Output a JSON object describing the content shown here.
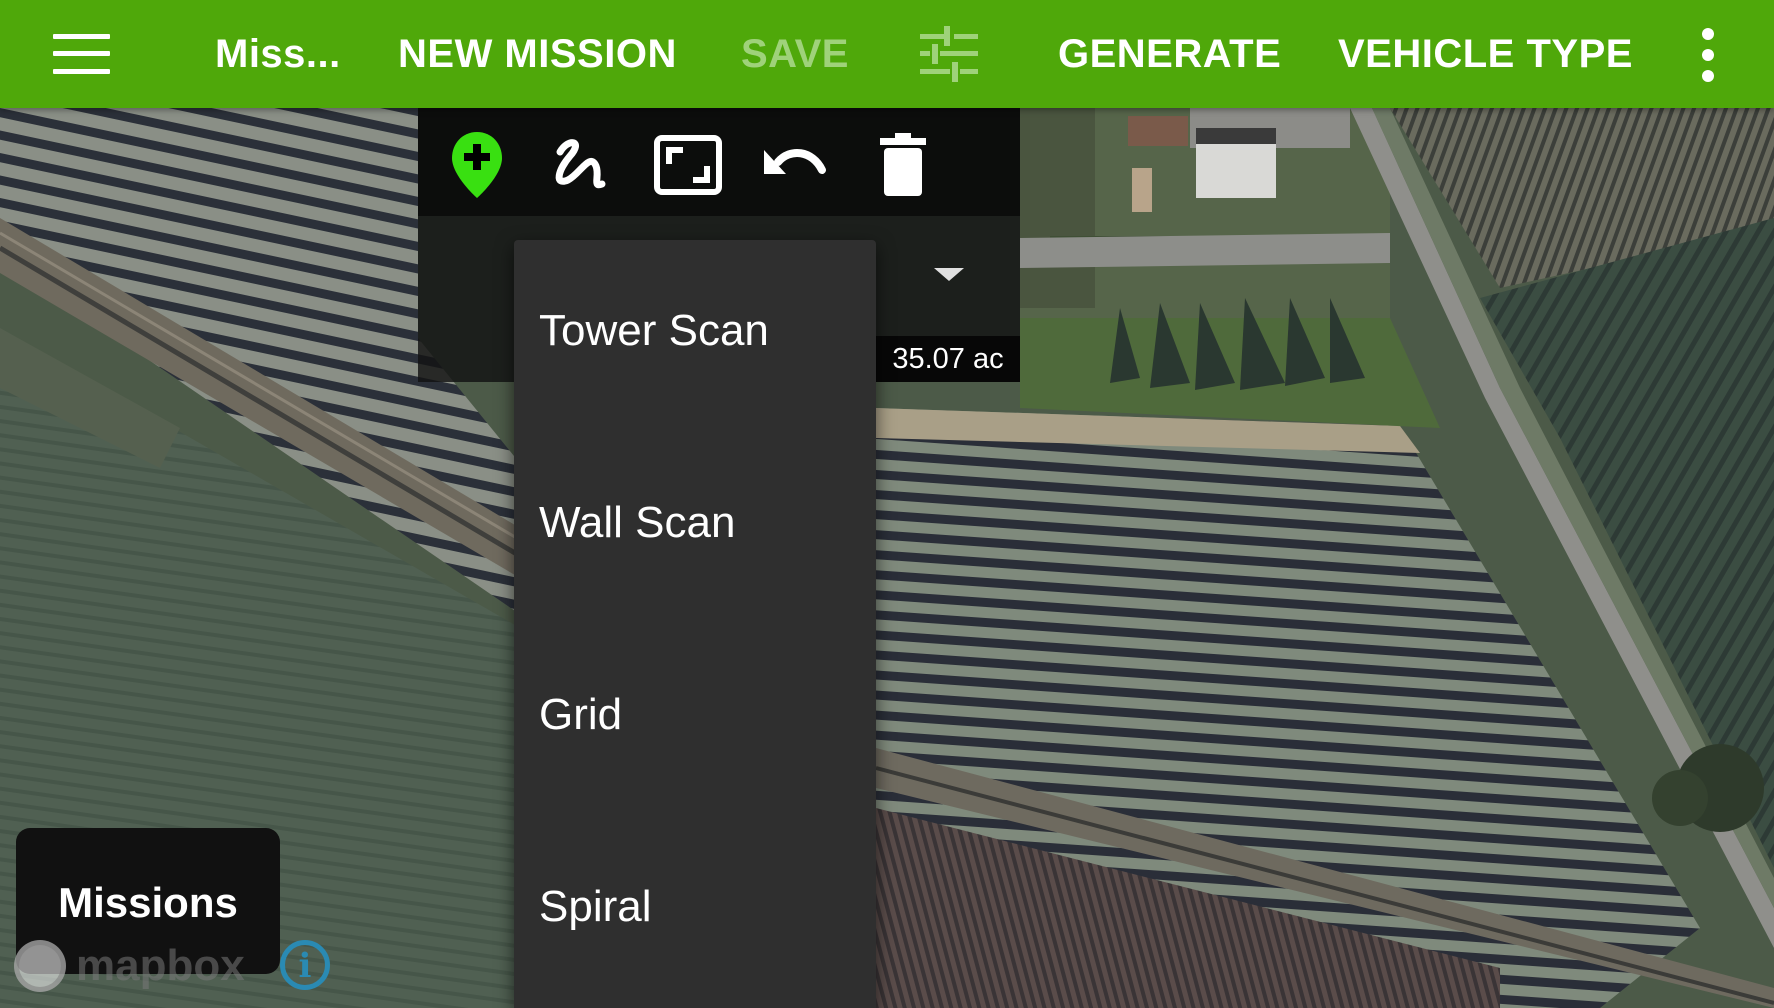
{
  "appbar": {
    "background": "#4fa80a",
    "menu_icon": "hamburger-icon",
    "mission_name": "Miss...",
    "new_mission_label": "NEW MISSION",
    "save_label": "SAVE",
    "settings_icon": "tune-icon",
    "generate_label": "GENERATE",
    "vehicle_type_label": "VEHICLE TYPE",
    "overflow_icon": "more-vert-icon"
  },
  "draw_toolbar": {
    "tools": [
      {
        "name": "add-waypoint",
        "icon": "add-location-icon",
        "color": "#39e011"
      },
      {
        "name": "draw-freehand",
        "icon": "freehand-draw-icon"
      },
      {
        "name": "polygon-area",
        "icon": "frame-corners-icon"
      },
      {
        "name": "undo",
        "icon": "undo-icon"
      },
      {
        "name": "delete",
        "icon": "trash-icon"
      }
    ],
    "area": "35.07 ac"
  },
  "pattern_menu": {
    "items": [
      "Tower Scan",
      "Wall Scan",
      "Grid",
      "Spiral"
    ]
  },
  "missions_button": "Missions",
  "map_attribution": {
    "logo_text": "mapbox",
    "info_icon": "i"
  }
}
